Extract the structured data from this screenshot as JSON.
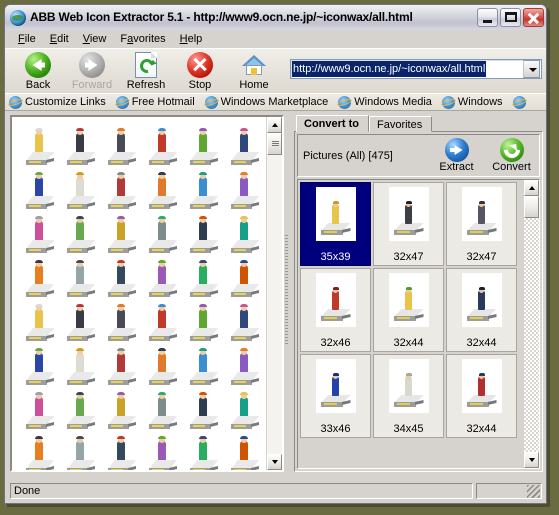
{
  "window": {
    "title": "ABB Web Icon Extractor 5.1 - http://www9.ocn.ne.jp/~iconwax/all.html",
    "app_icon": "globe-icon",
    "minimize_label": "",
    "maximize_label": "",
    "close_label": ""
  },
  "menu": {
    "items": [
      {
        "label": "File",
        "accel": "F"
      },
      {
        "label": "Edit",
        "accel": "E"
      },
      {
        "label": "View",
        "accel": "V"
      },
      {
        "label": "Favorites",
        "accel": "a"
      },
      {
        "label": "Help",
        "accel": "H"
      }
    ]
  },
  "toolbar": {
    "buttons": [
      {
        "label": "Back",
        "icon": "back-arrow-icon",
        "enabled": true
      },
      {
        "label": "Forward",
        "icon": "forward-arrow-icon",
        "enabled": false
      },
      {
        "label": "Refresh",
        "icon": "refresh-icon",
        "enabled": true
      },
      {
        "label": "Stop",
        "icon": "stop-icon",
        "enabled": true
      },
      {
        "label": "Home",
        "icon": "home-icon",
        "enabled": true
      }
    ]
  },
  "address": {
    "value": "http://www9.ocn.ne.jp/~iconwax/all.html",
    "placeholder": "Address",
    "dropdown_icon": "chevron-down-icon",
    "selected": true
  },
  "links": {
    "items": [
      {
        "label": "Customize Links",
        "icon": "ie-icon"
      },
      {
        "label": "Free Hotmail",
        "icon": "ie-icon"
      },
      {
        "label": "Windows Marketplace",
        "icon": "ie-icon"
      },
      {
        "label": "Windows Media",
        "icon": "ie-icon"
      },
      {
        "label": "Windows",
        "icon": "ie-icon"
      }
    ]
  },
  "panel": {
    "tabs": [
      {
        "label": "Convert to",
        "active": true
      },
      {
        "label": "Favorites",
        "active": false
      }
    ],
    "pictures_label": "Pictures (All) [475]",
    "extract_label": "Extract",
    "extract_icon": "extract-arrow-icon",
    "convert_label": "Convert",
    "convert_icon": "convert-arrow-icon",
    "thumbnails": [
      {
        "caption": "35x39",
        "selected": true
      },
      {
        "caption": "32x47",
        "selected": false
      },
      {
        "caption": "32x47",
        "selected": false
      },
      {
        "caption": "32x46",
        "selected": false
      },
      {
        "caption": "32x44",
        "selected": false
      },
      {
        "caption": "32x44",
        "selected": false
      },
      {
        "caption": "33x46",
        "selected": false
      },
      {
        "caption": "34x45",
        "selected": false
      },
      {
        "caption": "32x44",
        "selected": false
      }
    ]
  },
  "statusbar": {
    "text": "Done",
    "resize_grip": "resize-grip-icon"
  },
  "colors": {
    "title_active": "#d0d0da",
    "face": "#d6d3ce",
    "selection": "#00007f",
    "desktop": "#6b6b42",
    "address_highlight": "#0a246a"
  }
}
